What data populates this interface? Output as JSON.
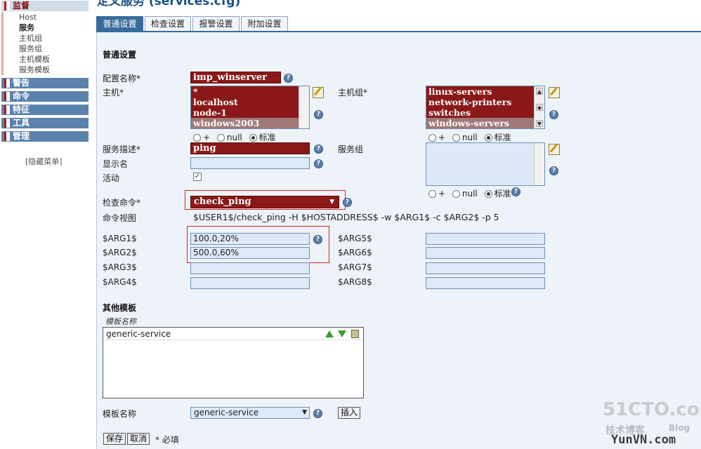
{
  "page_title": "定义服务 (services.cfg)",
  "sidebar": {
    "monitor": {
      "label": "监督",
      "items": [
        "Host",
        "服务",
        "主机组",
        "服务组",
        "主机模板",
        "服务模板"
      ]
    },
    "sections": [
      "警告",
      "命令",
      "特征",
      "工具",
      "管理"
    ],
    "hide_menu": "[隐藏菜单]"
  },
  "tabs": [
    "普通设置",
    "检查设置",
    "报警设置",
    "附加设置"
  ],
  "section_general": "普通设置",
  "form": {
    "config_name_label": "配置名称*",
    "config_name_value": "imp_winserver",
    "host_label": "主机*",
    "hosts": [
      "*",
      "localhost",
      "node-1",
      "windows2003"
    ],
    "hostgroup_label": "主机组*",
    "hostgroups": [
      "linux-servers",
      "network-printers",
      "switches",
      "windows-servers"
    ],
    "radio_plus": "+",
    "radio_null": "null",
    "radio_standard": "标准",
    "service_desc_label": "服务描述*",
    "service_desc_value": "ping",
    "servicegroup_label": "服务组",
    "display_name_label": "显示名",
    "display_name_value": "",
    "active_label": "活动",
    "active_check": "✓",
    "check_command_label": "检查命令*",
    "check_command_value": "check_ping",
    "command_view_label": "命令视图",
    "command_view_value": "$USER1$/check_ping -H $HOSTADDRESS$ -w $ARG1$ -c $ARG2$ -p 5",
    "arg_labels_left": [
      "$ARG1$",
      "$ARG2$",
      "$ARG3$",
      "$ARG4$"
    ],
    "arg_values_left": [
      "100.0,20%",
      "500.0,60%",
      "",
      ""
    ],
    "arg_labels_right": [
      "$ARG5$",
      "$ARG6$",
      "$ARG7$",
      "$ARG8$"
    ]
  },
  "templates": {
    "section_label": "其他模板",
    "column_header": "模板名称",
    "items": [
      "generic-service"
    ],
    "template_name_label": "模板名称",
    "template_select_value": "generic-service",
    "insert_button": "插入"
  },
  "footer": {
    "save": "保存",
    "cancel": "取消",
    "required_note": "* 必填"
  },
  "watermark": {
    "line1": "51CTO.com",
    "line2": "技术博客",
    "line3": "Blog",
    "line4": "YunVN.com"
  },
  "help_glyph": "?",
  "colors": {
    "accent": "#396c9c",
    "panel": "#eef3f9",
    "required_field": "#8b1818",
    "input_bg": "#dde9f8",
    "highlight_border": "#dd2222"
  }
}
